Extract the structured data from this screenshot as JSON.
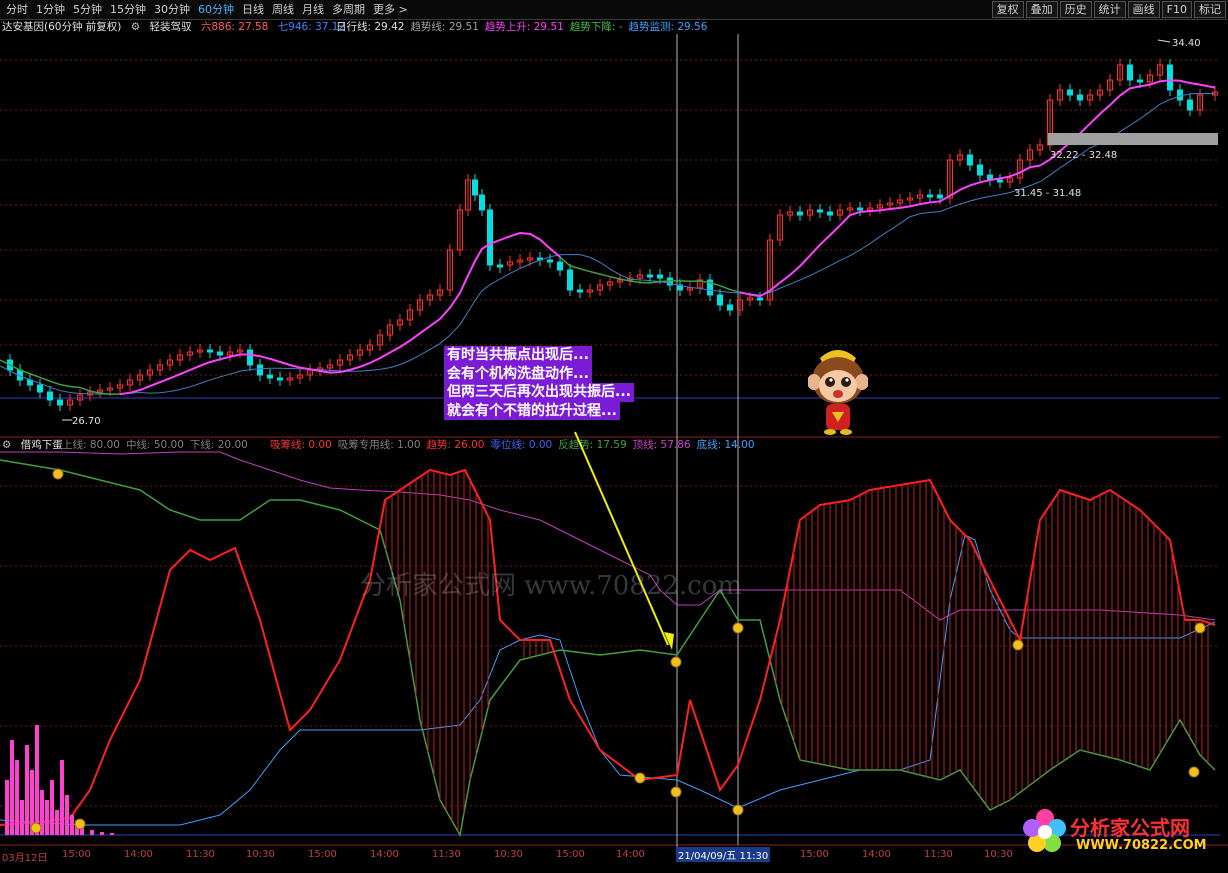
{
  "toolbar": {
    "periods": [
      "分时",
      "1分钟",
      "5分钟",
      "15分钟",
      "30分钟",
      "60分钟",
      "日线",
      "周线",
      "月线",
      "多周期",
      "更多 >"
    ],
    "active_period": "60分钟",
    "right_buttons": [
      "复权",
      "叠加",
      "历史",
      "统计",
      "画线",
      "F10",
      "标记"
    ]
  },
  "main_panel": {
    "stock": "达安基因(60分钟 前复权)",
    "indicator_name": "轻装驾驭",
    "ma_six_label": "六886: 27.58",
    "ma_seven_label": "七946: 37.12",
    "items": [
      {
        "label": "日行线: 29.42",
        "color": "#e0e0e0"
      },
      {
        "label": "趋势线: 29.51",
        "color": "#a0a0a0"
      },
      {
        "label": "趋势上升: 29.51",
        "color": "#ff40ff"
      },
      {
        "label": "趋势下降: -",
        "color": "#40c040"
      },
      {
        "label": "趋势监测: 29.56",
        "color": "#40a0ff"
      }
    ],
    "annotations": {
      "high": "34.40",
      "low": "26.70",
      "range1": "32.22 - 32.48",
      "range2": "31.45 - 31.48"
    }
  },
  "callout": {
    "lines": [
      "有时当共振点出现后...",
      "会有个机构洗盘动作...",
      "但两三天后再次出现共振后...",
      "就会有个不错的拉升过程..."
    ]
  },
  "sub_panel": {
    "name": "借鸡下蛋",
    "params": [
      {
        "label": "上线: 80.00",
        "color": "#808080"
      },
      {
        "label": "中线: 50.00",
        "color": "#808080"
      },
      {
        "label": "下线: 20.00",
        "color": "#808080"
      }
    ],
    "items": [
      {
        "label": "吸筹线: 0.00",
        "color": "#ff3030"
      },
      {
        "label": "吸筹专用线: 1.00",
        "color": "#808080"
      },
      {
        "label": "趋势: 26.00",
        "color": "#ff3030"
      },
      {
        "label": "零位线: 0.00",
        "color": "#4060ff"
      },
      {
        "label": "反趋势: 17.59",
        "color": "#40a040"
      },
      {
        "label": "顶线: 57.86",
        "color": "#d040d0"
      },
      {
        "label": "底线: 14.00",
        "color": "#40a0ff"
      }
    ]
  },
  "x_axis": {
    "labels": [
      "03月12日",
      "15:00",
      "14:00",
      "11:30",
      "10:30",
      "15:00",
      "14:00",
      "11:30",
      "10:30",
      "15:00",
      "14:00",
      "15:00",
      "14:00",
      "11:30",
      "10:30"
    ],
    "cursor_label": "21/04/09/五 11:30"
  },
  "watermark": "分析家公式网 www.70822.com",
  "logo": {
    "title": "分析家公式网",
    "url": "WWW.70822.COM"
  },
  "colors": {
    "up": "#ff3030",
    "down": "#00e0e0",
    "purple": "#ff40ff",
    "blue": "#4080ff",
    "green": "#40a040"
  }
}
